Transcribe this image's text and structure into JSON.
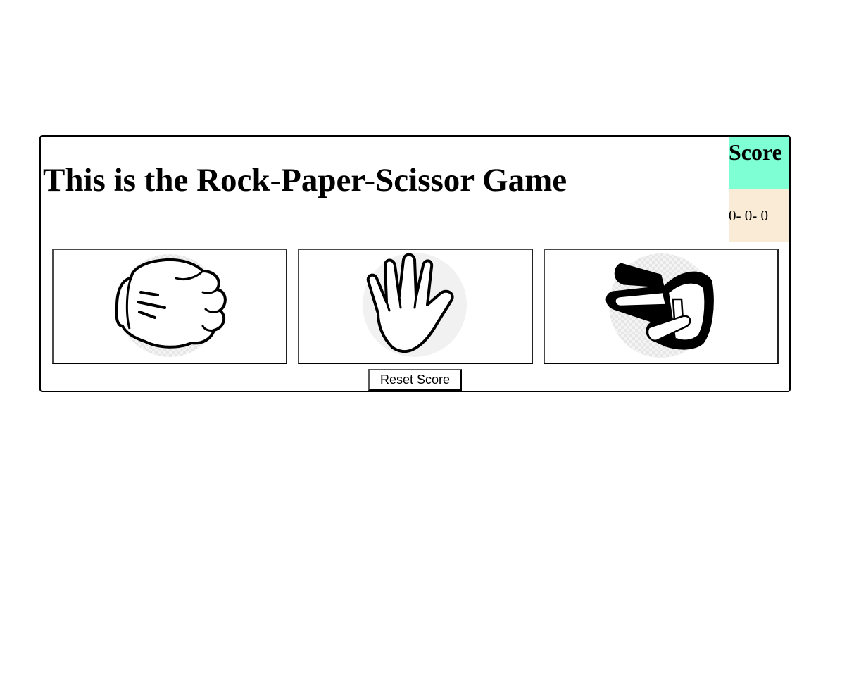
{
  "game": {
    "title": "This is the Rock-Paper-Scissor Game"
  },
  "score": {
    "header": "Score",
    "value": "0- 0- 0",
    "colors": {
      "header_bg": "#7fffd4",
      "value_bg": "#faebd7"
    }
  },
  "choices": [
    {
      "id": "rock",
      "icon": "rock-fist-icon"
    },
    {
      "id": "paper",
      "icon": "paper-open-hand-icon"
    },
    {
      "id": "scissor",
      "icon": "scissor-two-fingers-icon"
    }
  ],
  "controls": {
    "reset_label": "Reset Score"
  }
}
